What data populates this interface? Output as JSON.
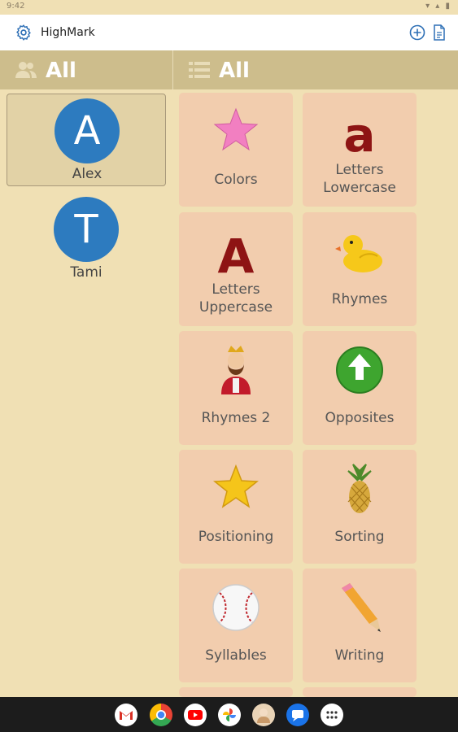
{
  "status": {
    "time": "9:42",
    "icons": "▾ ▴ ▮"
  },
  "app": {
    "title": "HighMark"
  },
  "users_header": {
    "label": "All"
  },
  "categories_header": {
    "label": "All"
  },
  "users": [
    {
      "initial": "A",
      "name": "Alex",
      "selected": true
    },
    {
      "initial": "T",
      "name": "Tami",
      "selected": false
    }
  ],
  "tiles": [
    {
      "label": "Colors",
      "icon": "pink-star-icon"
    },
    {
      "label": "Letters Lowercase",
      "icon": "lowercase-a-icon"
    },
    {
      "label": "Letters Uppercase",
      "icon": "uppercase-a-icon"
    },
    {
      "label": "Rhymes",
      "icon": "rubber-duck-icon"
    },
    {
      "label": "Rhymes 2",
      "icon": "king-icon"
    },
    {
      "label": "Opposites",
      "icon": "green-up-arrow-icon"
    },
    {
      "label": "Positioning",
      "icon": "gold-star-icon"
    },
    {
      "label": "Sorting",
      "icon": "pineapple-icon"
    },
    {
      "label": "Syllables",
      "icon": "baseball-icon"
    },
    {
      "label": "Writing",
      "icon": "pencil-icon"
    }
  ],
  "taskbar": [
    "gmail-icon",
    "chrome-icon",
    "youtube-icon",
    "photos-icon",
    "contact-avatar-icon",
    "messages-icon",
    "app-drawer-icon"
  ],
  "colors": {
    "background": "#f0e0b4",
    "header": "#cdbd8c",
    "tile": "#f2cdae",
    "avatar": "#2d7bbf"
  }
}
